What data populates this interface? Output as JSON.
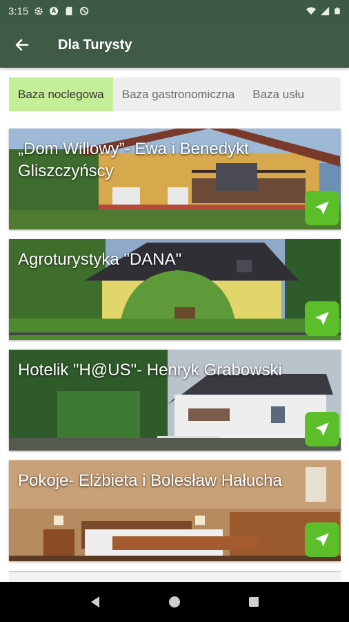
{
  "status_bar": {
    "time": "3:15",
    "icons_left": [
      "gear-icon",
      "location-a-icon",
      "sd-card-icon",
      "no-entry-icon"
    ],
    "icons_right": [
      "wifi-icon",
      "signal-icon",
      "battery-icon"
    ]
  },
  "app_bar": {
    "title": "Dla Turysty",
    "back_icon": "arrow-left-icon",
    "color": "#3f5b46"
  },
  "tabs": [
    {
      "label": "Baza noclegowa",
      "active": true
    },
    {
      "label": "Baza gastronomiczna",
      "active": false
    },
    {
      "label": "Baza usłu",
      "active": false
    }
  ],
  "cards": [
    {
      "title": "„Dom Willowy”- Ewa i Benedykt Gliszczyńscy",
      "action_icon": "navigate-icon"
    },
    {
      "title": "Agroturystyka \"DANA\"",
      "action_icon": "navigate-icon"
    },
    {
      "title": "Hotelik \"H@US\"- Henryk Grabowski",
      "action_icon": "navigate-icon"
    },
    {
      "title": "Pokoje- Elżbieta i Bolesław Hałucha",
      "action_icon": "navigate-icon"
    }
  ],
  "colors": {
    "accent": "#5cbf2a",
    "active_tab": "#c5ee99",
    "status_bar": "#3d5a44"
  },
  "nav_bar": {
    "buttons": [
      "back-triangle-icon",
      "home-circle-icon",
      "recents-square-icon"
    ]
  }
}
